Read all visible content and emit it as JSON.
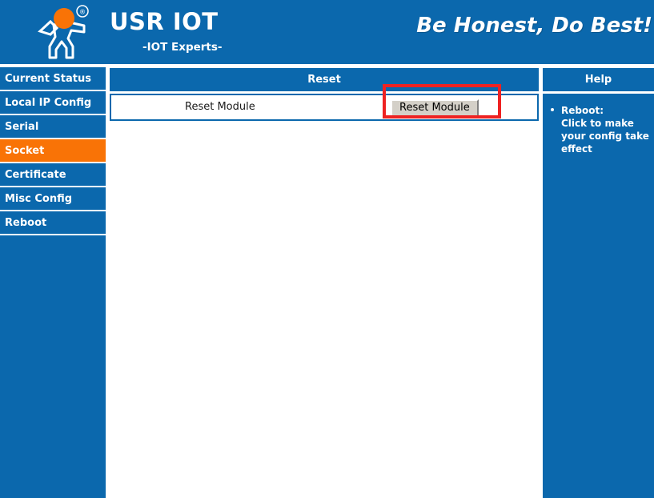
{
  "header": {
    "logo_icon": "usr-running-man-logo",
    "trademark": "®",
    "brand_title": "USR IOT",
    "brand_subtitle": "-IOT Experts-",
    "slogan": "Be Honest, Do Best!"
  },
  "sidebar": {
    "items": [
      {
        "label": "Current Status",
        "active": false
      },
      {
        "label": "Local IP Config",
        "active": false
      },
      {
        "label": "Serial",
        "active": false
      },
      {
        "label": "Socket",
        "active": true
      },
      {
        "label": "Certificate",
        "active": false
      },
      {
        "label": "Misc Config",
        "active": false
      },
      {
        "label": "Reboot",
        "active": false
      }
    ]
  },
  "main": {
    "panel_title": "Reset",
    "row_label": "Reset Module",
    "button_label": "Reset Module"
  },
  "help": {
    "title": "Help",
    "entries": [
      {
        "term": "Reboot:",
        "description": "Click to make your config take effect"
      }
    ]
  },
  "colors": {
    "brand_blue": "#0b68ad",
    "accent_orange": "#f97306",
    "annotation_red": "#ee2222",
    "button_face": "#d4d0c8"
  }
}
